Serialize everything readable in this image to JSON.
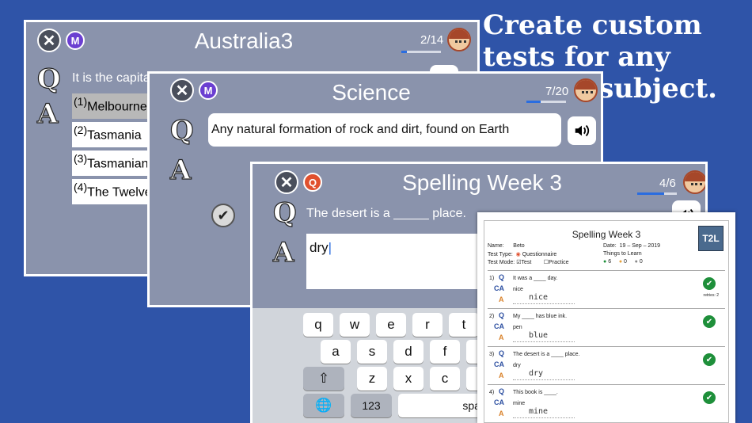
{
  "headline": [
    "Create custom",
    "tests for any",
    "subject."
  ],
  "screen1": {
    "title": "Australia3",
    "progress": "2/14",
    "progress_fraction": 0.143,
    "mode": "M",
    "question": "It is the capital of",
    "options": [
      {
        "num": "(1)",
        "text": "Melbourne"
      },
      {
        "num": "(2)",
        "text": "Tasmania"
      },
      {
        "num": "(3)",
        "text": "Tasmanian"
      },
      {
        "num": "(4)",
        "text": "The  Twelve"
      }
    ]
  },
  "screen2": {
    "title": "Science",
    "progress": "7/20",
    "progress_fraction": 0.35,
    "mode": "M",
    "question": "Any natural formation of rock and dirt, found on Earth"
  },
  "screen3": {
    "title": "Spelling Week 3",
    "progress": "4/6",
    "progress_fraction": 0.667,
    "mode": "Q",
    "question": "The desert is a _____ place.",
    "answer": "dry",
    "keyboard": {
      "row1": [
        "q",
        "w",
        "e",
        "r",
        "t"
      ],
      "row2": [
        "a",
        "s",
        "d",
        "f",
        "g"
      ],
      "row3": [
        "z",
        "x",
        "c",
        "v"
      ],
      "numbers_key": "123",
      "space_key": "space"
    }
  },
  "report": {
    "title": "Spelling Week 3",
    "logo": "T2L",
    "name_label": "Name:",
    "name": "Beto",
    "date_label": "Date:",
    "date": "19 – Sep – 2019",
    "test_type_label": "Test Type:",
    "test_type": "Questionnaire",
    "test_mode_label": "Test Mode:",
    "mode_test": "Test",
    "mode_practice": "Practice",
    "things_label": "Things to Learn",
    "count_correct": "6",
    "count_wrong": "0",
    "count_other": "0",
    "items": [
      {
        "num": "1)",
        "question": "It was a ____ day.",
        "correct": "nice",
        "answer": "nice",
        "note": "retries: 2"
      },
      {
        "num": "2)",
        "question": "My ____ has blue ink.",
        "correct": "pen",
        "answer": "blue",
        "note": ""
      },
      {
        "num": "3)",
        "question": "The desert is a ____ place.",
        "correct": "dry",
        "answer": "dry",
        "note": ""
      },
      {
        "num": "4)",
        "question": "This book is ____.",
        "correct": "mine",
        "answer": "mine",
        "note": ""
      }
    ]
  }
}
